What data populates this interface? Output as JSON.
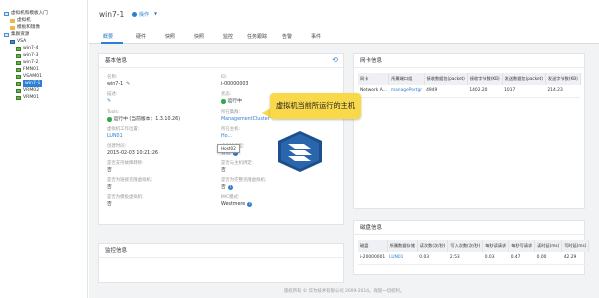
{
  "sidebar": {
    "items": [
      {
        "label": "虚拟机和模板入门",
        "icon": "tree-icon",
        "indent": 0
      },
      {
        "label": "虚拟机",
        "icon": "folder-icon",
        "indent": 1
      },
      {
        "label": "模板和镜像",
        "icon": "folder-icon",
        "indent": 1
      },
      {
        "label": "集群资源",
        "icon": "tree-icon",
        "indent": 0
      },
      {
        "label": "VSA",
        "icon": "host-icon",
        "indent": 1
      },
      {
        "label": "win7-4",
        "icon": "vm-icon",
        "indent": 2
      },
      {
        "label": "win7-3",
        "icon": "vm-icon",
        "indent": 2
      },
      {
        "label": "win7-2",
        "icon": "vm-icon",
        "indent": 2
      },
      {
        "label": "FMN01",
        "icon": "vm-icon",
        "indent": 2
      },
      {
        "label": "VSAM01",
        "icon": "vm-icon",
        "indent": 2
      },
      {
        "label": "win7-1",
        "icon": "vm-icon",
        "indent": 2,
        "selected": true
      },
      {
        "label": "VRM02",
        "icon": "vm-icon",
        "indent": 2
      },
      {
        "label": "VRM01",
        "icon": "vm-icon",
        "indent": 2
      }
    ]
  },
  "header": {
    "vm_name": "win7-1",
    "ops_label": "操作"
  },
  "tabs": [
    "概要",
    "硬件",
    "快照",
    "快照",
    "监控",
    "任务跟踪",
    "告警",
    "事件"
  ],
  "basic": {
    "title": "基本信息",
    "name_k": "名称:",
    "name_v": "win7-1",
    "id_k": "ID:",
    "id_v": "i-00000003",
    "desc_k": "描述:",
    "status_k": "状态:",
    "status_v": "运行中",
    "tools_k": "Tools:",
    "tools_v": "运行中 (当前版本：1.3.10.26)",
    "belong_k": "所在集群:",
    "belong_v": "ManagementCluster",
    "vmstate_k": "虚拟机工作位置:",
    "vmstate_v": "LUN01",
    "host_k": "所在主机:",
    "host_v": "Ho...",
    "created_k": "创建时间:",
    "created_v": "2015-02-03 10:21:26",
    "vmtype_k": "虚拟机类型:",
    "vmtype_v": "普通",
    "ha_k": "是否支持故障转移:",
    "ha_v": "否",
    "hostbind_k": "是否与主机绑定:",
    "hostbind_v": "否",
    "linkclone_k": "是否为链接克隆虚拟机:",
    "linkclone_v": "否",
    "fullclone_k": "是否为完整克隆虚拟机:",
    "fullclone_v": "否",
    "template_k": "是否为模板虚拟机:",
    "template_v": "否",
    "imc_k": "IMC模式:",
    "imc_v": "Westmere"
  },
  "monitor": {
    "title": "监控信息"
  },
  "nic": {
    "title": "网卡信息",
    "headers": [
      "网卡",
      "所属端口组",
      "接收数据包(packet)",
      "接收字节数(KB)",
      "发送数据包(packet)",
      "发送字节数(KB)"
    ],
    "rows": [
      [
        "Network A...",
        "managePortgr",
        "4949",
        "1402.20",
        "1017",
        "214.23"
      ]
    ]
  },
  "disk": {
    "title": "磁盘信息",
    "headers": [
      "磁盘",
      "所属数据存储",
      "读次数(次/秒)",
      "写入次数(次/秒)",
      "每秒读请求",
      "每秒写请求",
      "读时延(ms)",
      "写时延(ms)"
    ],
    "rows": [
      [
        "i-20000001",
        "LUN01",
        "0.03",
        "2.53",
        "0.03",
        "0.47",
        "0.00",
        "42.29"
      ]
    ]
  },
  "callout": {
    "text": "虚拟机当前所运行的主机"
  },
  "tooltip": {
    "text": "Host02"
  },
  "footer": {
    "text": "版权所有 © 华为技术有限公司 2009-2014。保留一切权利。"
  },
  "colors": {
    "accent": "#2c7fd2",
    "callout": "#f9d84a",
    "selected": "#2c7fd2",
    "running": "#33a84e"
  }
}
